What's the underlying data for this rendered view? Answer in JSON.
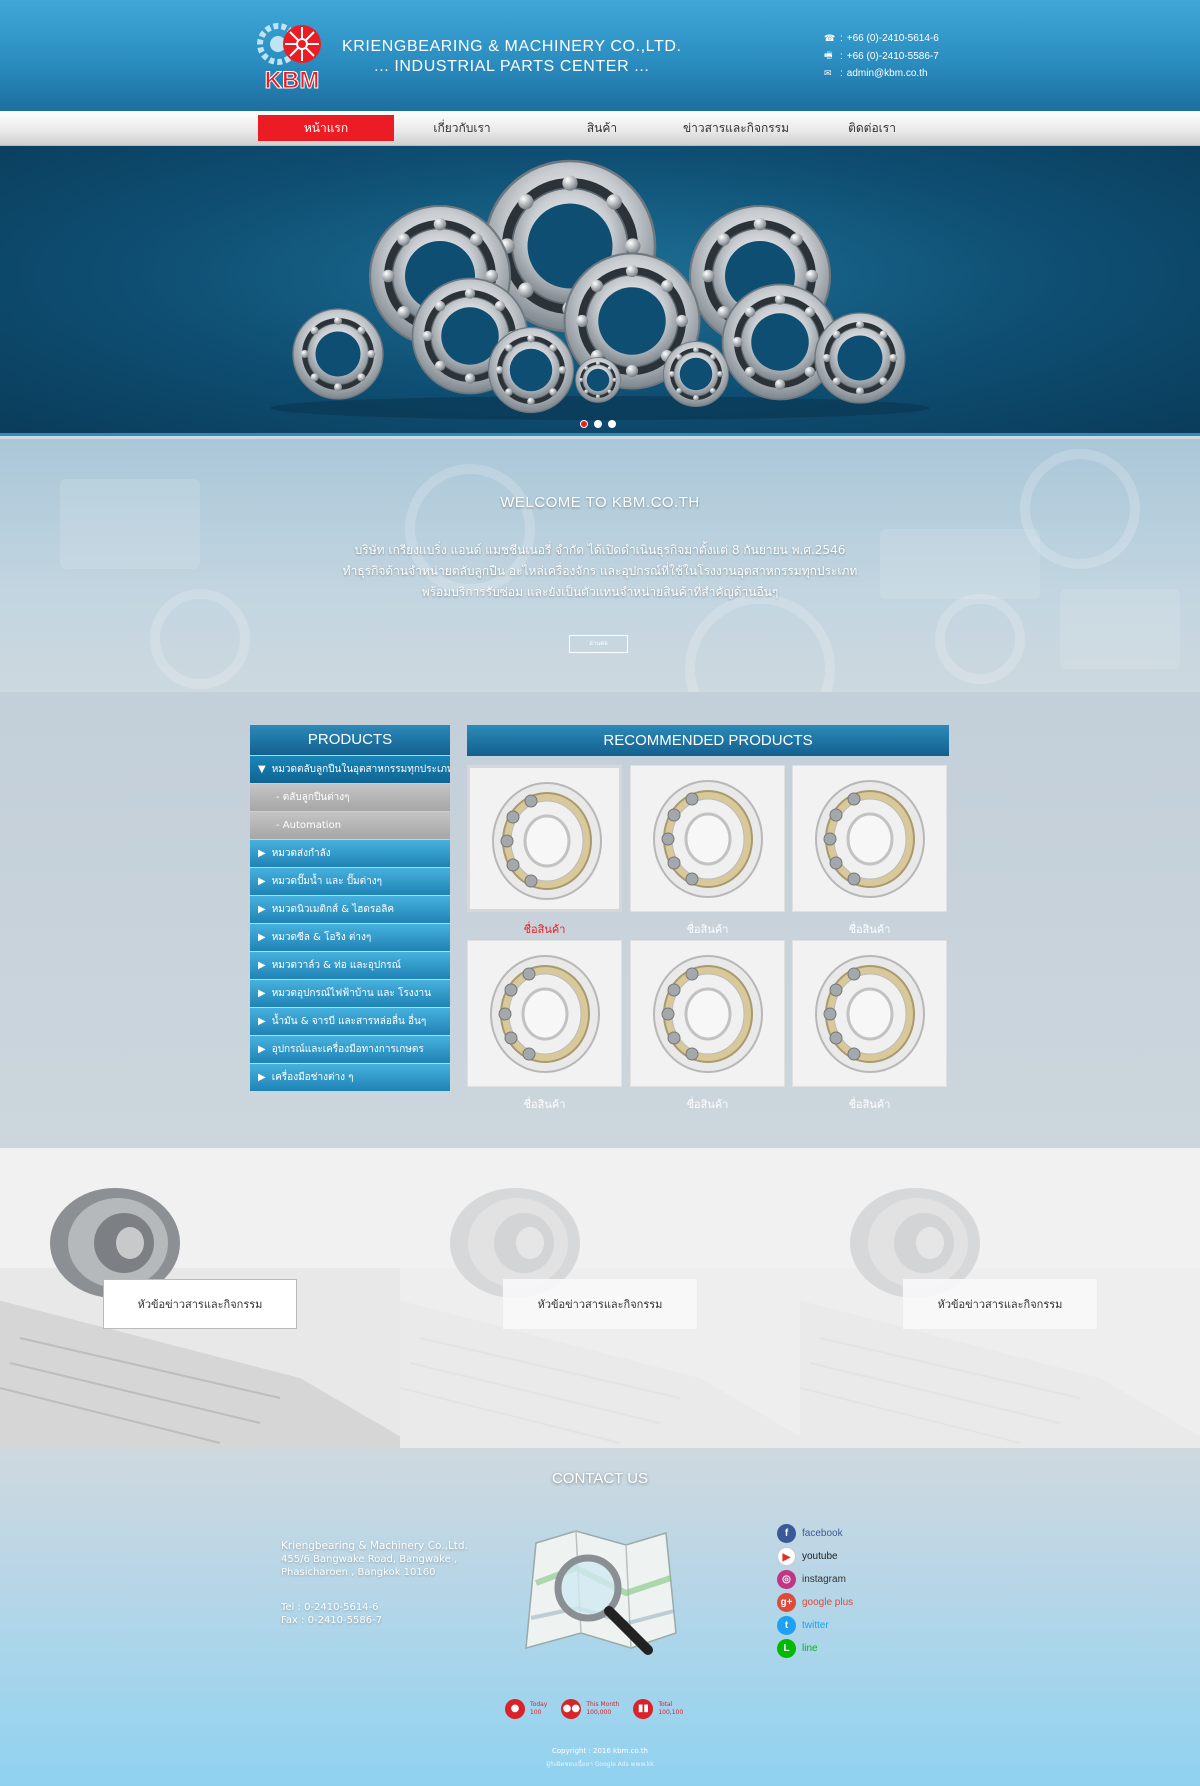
{
  "header": {
    "logo_text": "KBM",
    "company_line1": "KRIENGBEARING & MACHINERY CO.,LTD.",
    "company_line2": "... INDUSTRIAL PARTS CENTER ...",
    "phone": "+66 (0)-2410-5614-6",
    "fax": "+66 (0)-2410-5586-7",
    "email": "admin@kbm.co.th"
  },
  "nav": [
    "หน้าแรก",
    "เกี่ยวกับเรา",
    "สินค้า",
    "ข่าวสารและกิจกรรม",
    "ติดต่อเรา"
  ],
  "welcome": {
    "title": "WELCOME TO KBM.CO.TH",
    "line1": "บริษัท เกรียงแบริ่ง แอนด์ แมชชีนเนอรี่ จำกัด ได้เปิดดำเนินธุรกิจมาตั้งแต่ 8 กันยายน พ.ศ.2546",
    "line2": "ทำธุรกิจด้านจำหน่ายตลับลูกปืน อะไหล่เครื่องจักร และอุปกรณ์ที่ใช้ในโรงงานอุตสาหกรรมทุกประเภท",
    "line3": "พร้อมบริการรับซ่อม และยังเป็นตัวแทนจำหน่ายสินค้าที่สำคัญด้านอื่นๆ",
    "readmore": "อ่านต่อ"
  },
  "products": {
    "title": "PRODUCTS",
    "open_category": "หมวดตลับลูกปืนในอุตสาหกรรมทุกประเภท",
    "subitems": [
      "- ตลับลูกปืนต่างๆ",
      "- Automation"
    ],
    "categories": [
      "หมวดส่งกำลัง",
      "หมวดปั๊มน้ำ และ ปั๊มต่างๆ",
      "หมวดนิวเมติกส์ & ไฮดรอลิค",
      "หมวดซีล & โอริง ต่างๆ",
      "หมวดวาล์ว & ท่อ และอุปกรณ์",
      "หมวดอุปกรณ์ไฟฟ้าบ้าน และ โรงงาน",
      "น้ำมัน & จารบี และสารหล่อลื่น อื่นๆ",
      "อุปกรณ์และเครื่องมือทางการเกษตร",
      "เครื่องมือช่างต่าง ๆ"
    ]
  },
  "recommended": {
    "title": "RECOMMENDED PRODUCTS",
    "items": [
      "ชื่อสินค้า",
      "ชื่อสินค้า",
      "ชื่อสินค้า",
      "ชื่อสินค้า",
      "ชื่อสินค้า",
      "ชื่อสินค้า"
    ]
  },
  "news": [
    "หัวข้อข่าวสารและกิจกรรม",
    "หัวข้อข่าวสารและกิจกรรม",
    "หัวข้อข่าวสารและกิจกรรม"
  ],
  "contact": {
    "title": "CONTACT US",
    "company": "Kriengbearing & Machinery Co.,Ltd.",
    "addr1": "455/6 Bangwake Road, Bangwake ,",
    "addr2": "Phasicharoen , Bangkok 10160",
    "tel": "Tel : 0-2410-5614-6",
    "fax": "Fax : 0-2410-5586-7"
  },
  "social": [
    {
      "label": "facebook",
      "icon": "facebook-icon",
      "glyph": "f",
      "bg": "#3b5998",
      "color": "#3b5998"
    },
    {
      "label": "youtube",
      "icon": "youtube-icon",
      "glyph": "▶",
      "bg": "#ffffff",
      "color": "#222222"
    },
    {
      "label": "instagram",
      "icon": "instagram-icon",
      "glyph": "◎",
      "bg": "#c13584",
      "color": "#333333"
    },
    {
      "label": "google plus",
      "icon": "google-plus-icon",
      "glyph": "g+",
      "bg": "#dd4b39",
      "color": "#dd4b39"
    },
    {
      "label": "twitter",
      "icon": "twitter-icon",
      "glyph": "t",
      "bg": "#1da1f2",
      "color": "#1da1f2"
    },
    {
      "label": "line",
      "icon": "line-icon",
      "glyph": "L",
      "bg": "#00b900",
      "color": "#00b900"
    }
  ],
  "stats": [
    {
      "label": "Today",
      "value": "100",
      "icon": "user-icon"
    },
    {
      "label": "This Month",
      "value": "100,000",
      "icon": "users-icon"
    },
    {
      "label": "Total",
      "value": "100,100",
      "icon": "bar-chart-icon"
    }
  ],
  "footer": {
    "copyright": "Copyright : 2016 kbm.co.th",
    "credit": "ผู้รับผิดชอบเนื้อหา Google Ads www.kk"
  },
  "colors": {
    "accent": "#ec1c24",
    "header": "#2b8dc0",
    "panel": "#13608e"
  }
}
